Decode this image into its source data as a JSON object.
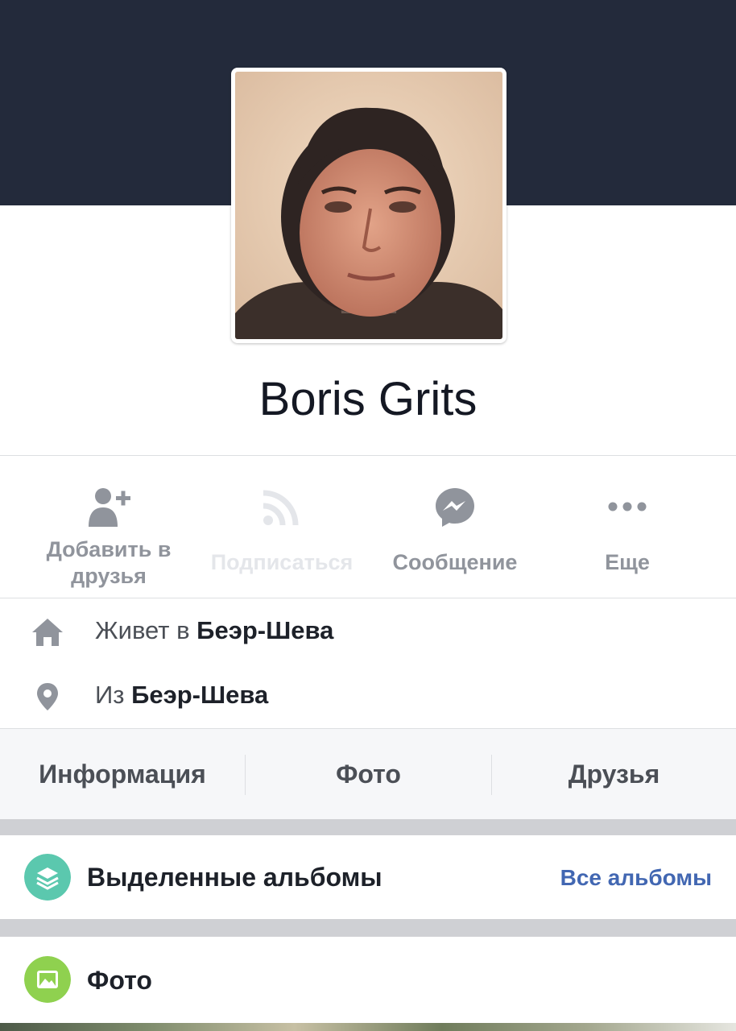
{
  "profile": {
    "name": "Boris Grits"
  },
  "actions": [
    {
      "label": "Добавить в\nдрузья",
      "icon": "add-friend-icon",
      "enabled": true
    },
    {
      "label": "Подписаться",
      "icon": "rss-follow-icon",
      "enabled": false
    },
    {
      "label": "Сообщение",
      "icon": "messenger-icon",
      "enabled": true
    },
    {
      "label": "Еще",
      "icon": "more-dots-icon",
      "enabled": true
    }
  ],
  "info": {
    "lives_prefix": "Живет в ",
    "lives_city": "Беэр-Шева",
    "from_prefix": "Из ",
    "from_city": "Беэр-Шева"
  },
  "tabs": [
    "Информация",
    "Фото",
    "Друзья"
  ],
  "featured_albums": {
    "title": "Выделенные альбомы",
    "link": "Все альбомы",
    "icon": "albums-stack-icon",
    "icon_color": "#5bc8ae"
  },
  "photos": {
    "title": "Фото",
    "icon": "photo-icon",
    "icon_color": "#8fd14f"
  },
  "colors": {
    "cover": "#232a3b",
    "link": "#4267b2",
    "text_gray": "#90949c"
  }
}
